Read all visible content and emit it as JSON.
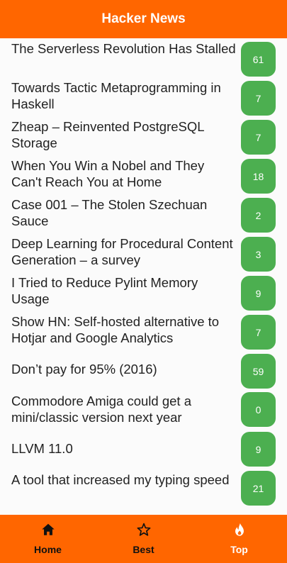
{
  "app_bar": {
    "title": "Hacker News"
  },
  "colors": {
    "brand": "#ff6600",
    "badge": "#4caf50",
    "active_nav": "#ffffff",
    "inactive_nav": "#111111"
  },
  "stories": [
    {
      "title": "The Serverless Revolution Has Stalled",
      "score": "61"
    },
    {
      "title": "Towards Tactic Metaprogramming in Haskell",
      "score": "7"
    },
    {
      "title": "Zheap – Reinvented PostgreSQL Storage",
      "score": "7"
    },
    {
      "title": "When You Win a Nobel and They Can't Reach You at Home",
      "score": "18"
    },
    {
      "title": "Case 001 – The Stolen Szechuan Sauce",
      "score": "2"
    },
    {
      "title": "Deep Learning for Procedural Content Generation – a survey",
      "score": "3"
    },
    {
      "title": "I Tried to Reduce Pylint Memory Usage",
      "score": "9"
    },
    {
      "title": "Show HN: Self-hosted alternative to Hotjar and Google Analytics",
      "score": "7"
    },
    {
      "title": "Don’t pay for 95% (2016)",
      "score": "59"
    },
    {
      "title": "Commodore Amiga could get a mini/classic version next year",
      "score": "0"
    },
    {
      "title": "LLVM 11.0",
      "score": "9"
    },
    {
      "title": "A tool that increased my typing speed",
      "score": "21"
    }
  ],
  "bottom_nav": {
    "items": [
      {
        "label": "Home",
        "icon": "home-icon"
      },
      {
        "label": "Best",
        "icon": "star-icon"
      },
      {
        "label": "Top",
        "icon": "flame-icon",
        "active": true
      }
    ]
  }
}
